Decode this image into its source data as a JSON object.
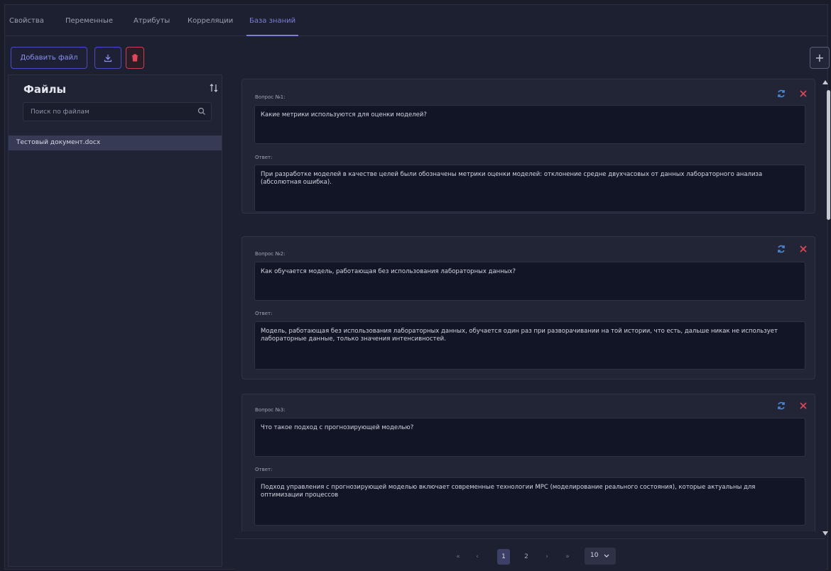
{
  "tabs": [
    {
      "label": "Свойства"
    },
    {
      "label": "Переменные"
    },
    {
      "label": "Атрибуты"
    },
    {
      "label": "Корреляции"
    },
    {
      "label": "База знаний"
    }
  ],
  "toolbar": {
    "add_file_label": "Добавить файл",
    "add_label": "+"
  },
  "sidebar": {
    "title": "Файлы",
    "search_placeholder": "Поиск по файлам",
    "files": [
      {
        "name": "Тестовый документ.docx"
      }
    ]
  },
  "qa": [
    {
      "question_label": "Вопрос №1:",
      "question": "Какие метрики используются для оценки моделей?",
      "answer_label": "Ответ:",
      "answer": "При разработке моделей в качестве целей были обозначены метрики оценки моделей: отклонение средне двухчасовых от данных лабораторного анализа (абсолютная ошибка)."
    },
    {
      "question_label": "Вопрос №2:",
      "question": "Как обучается модель, работающая без использования лабораторных данных?",
      "answer_label": "Ответ:",
      "answer": "Модель, работающая без использования лабораторных данных, обучается один раз при разворачивании на той истории, что есть, дальше никак не использует лабораторные данные, только значения интенсивностей."
    },
    {
      "question_label": "Вопрос №3:",
      "question": "Что такое подход с прогнозирующей моделью?",
      "answer_label": "Ответ:",
      "answer": "Подход управления с прогнозирующей моделью включает современные технологии MPC (моделирование реального состояния), которые актуальны для оптимизации процессов"
    }
  ],
  "pagination": {
    "first": "«",
    "prev": "‹",
    "page1": "1",
    "page2": "2",
    "next": "›",
    "last": "»",
    "page_size": "10"
  },
  "colors": {
    "accent": "#7c7fd9",
    "danger": "#e0485a",
    "refresh": "#4b8ad9",
    "background": "#1d2030"
  }
}
